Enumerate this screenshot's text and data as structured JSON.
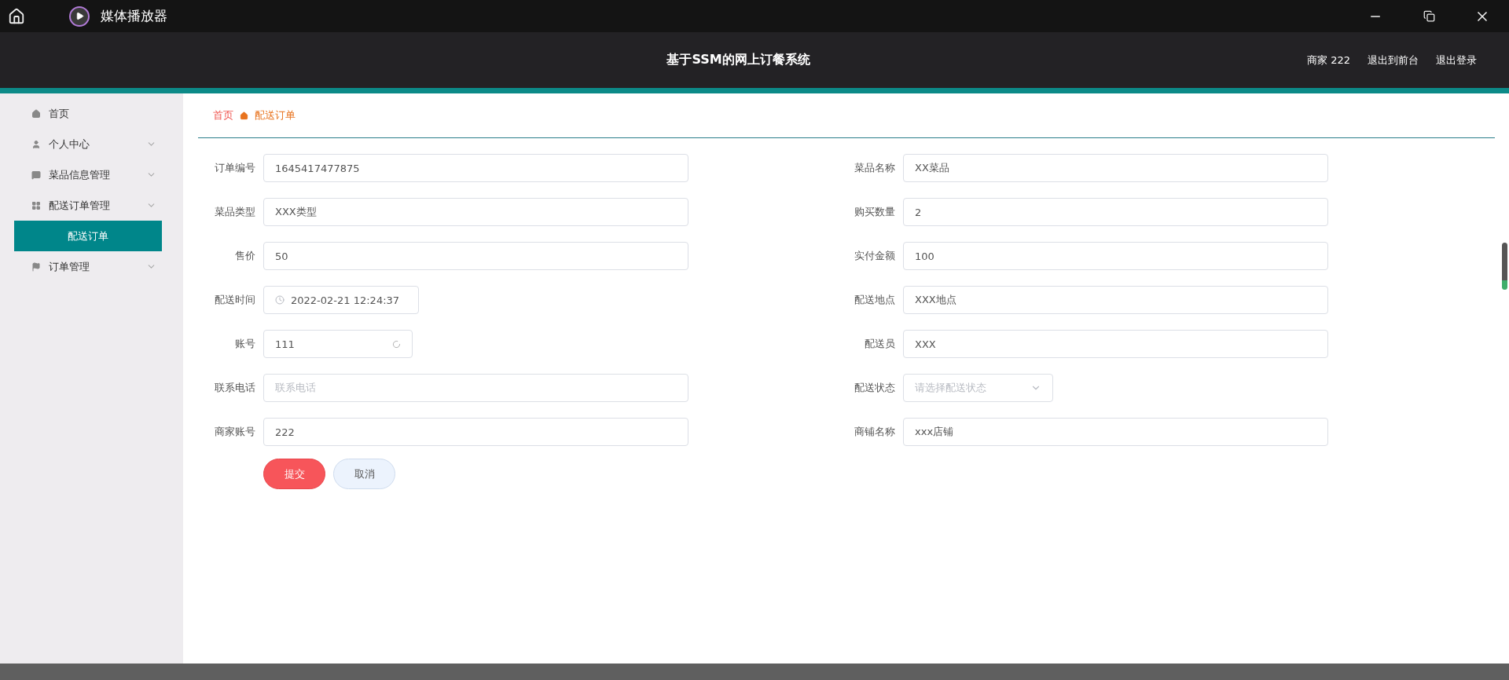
{
  "window": {
    "title": "媒体播放器"
  },
  "header": {
    "title": "基于SSM的网上订餐系统",
    "links": [
      "商家 222",
      "退出到前台",
      "退出登录"
    ]
  },
  "sidebar": {
    "items": [
      {
        "label": "首页",
        "kind": "link"
      },
      {
        "label": "个人中心",
        "kind": "group"
      },
      {
        "label": "菜品信息管理",
        "kind": "group"
      },
      {
        "label": "配送订单管理",
        "kind": "group",
        "children": [
          {
            "label": "配送订单",
            "selected": true
          }
        ]
      },
      {
        "label": "订单管理",
        "kind": "group"
      }
    ]
  },
  "breadcrumb": [
    "首页",
    "配送订单"
  ],
  "form": {
    "fields": [
      {
        "label": "订单编号",
        "kind": "text",
        "value": "1645417477875"
      },
      {
        "label": "菜品名称",
        "kind": "text",
        "value": "XX菜品"
      },
      {
        "label": "菜品类型",
        "kind": "text",
        "value": "XXX类型"
      },
      {
        "label": "购买数量",
        "kind": "text",
        "value": "2"
      },
      {
        "label": "售价",
        "kind": "text",
        "value": "50"
      },
      {
        "label": "实付金额",
        "kind": "text",
        "value": "100"
      },
      {
        "label": "配送时间",
        "kind": "date",
        "value": "2022-02-21 12:24:37"
      },
      {
        "label": "配送地点",
        "kind": "text",
        "value": "XXX地点"
      },
      {
        "label": "账号",
        "kind": "loading",
        "value": "111"
      },
      {
        "label": "配送员",
        "kind": "text",
        "value": "XXX"
      },
      {
        "label": "联系电话",
        "kind": "text",
        "placeholder": "联系电话"
      },
      {
        "label": "配送状态",
        "kind": "select",
        "placeholder": "请选择配送状态"
      },
      {
        "label": "商家账号",
        "kind": "text",
        "value": "222"
      },
      {
        "label": "商铺名称",
        "kind": "text",
        "value": "xxx店铺"
      }
    ],
    "buttons": [
      {
        "label": "提交",
        "kind": "primary"
      },
      {
        "label": "取消",
        "kind": "secondary"
      }
    ]
  }
}
